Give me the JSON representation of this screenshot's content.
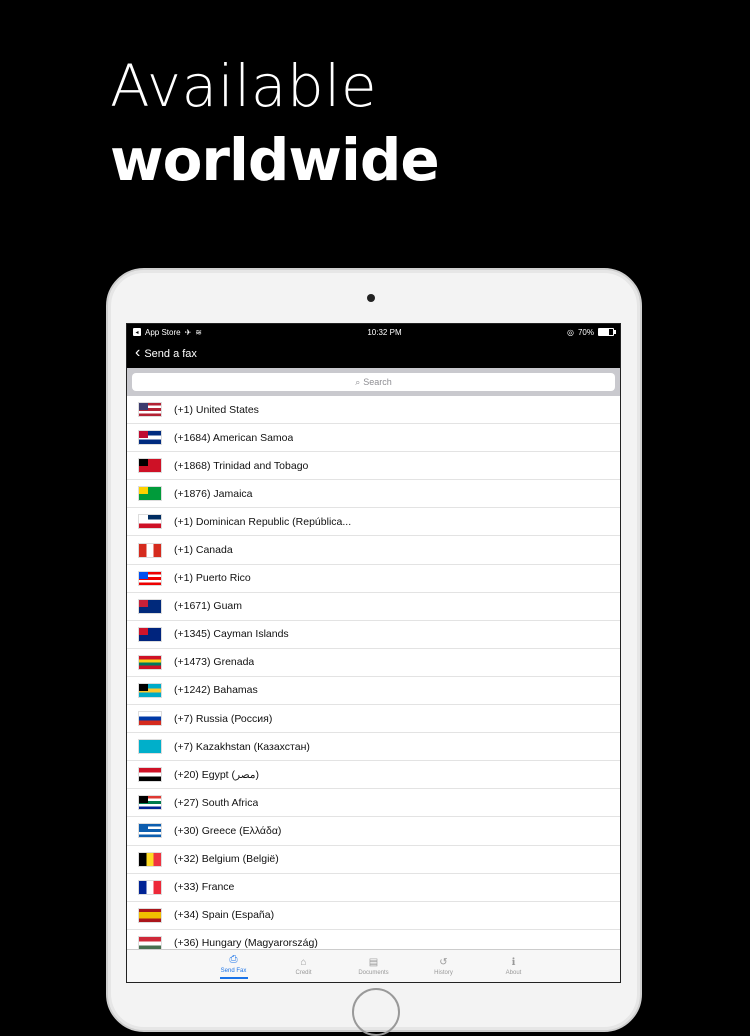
{
  "headline": {
    "line1": "Available",
    "line2": "worldwide"
  },
  "statusbar": {
    "back_app": "App Store",
    "time": "10:32 PM",
    "battery": "70%",
    "battery_level": 0.7
  },
  "navbar": {
    "back_label": "Send a fax"
  },
  "search": {
    "placeholder": "Search"
  },
  "countries": [
    {
      "label": "(+1) United States",
      "flag": [
        "#b22234",
        "#ffffff",
        "#b22234",
        "#ffffff",
        "#b22234"
      ],
      "canton": "#3c3b6e"
    },
    {
      "label": "(+1684) American Samoa",
      "flag": [
        "#002b7f",
        "#ffffff",
        "#002b7f"
      ],
      "canton": "#bf0a30"
    },
    {
      "label": "(+1868) Trinidad and Tobago",
      "flag": [
        "#ce1126"
      ],
      "canton": "#000000"
    },
    {
      "label": "(+1876) Jamaica",
      "flag": [
        "#009b3a"
      ],
      "canton": "#fed100"
    },
    {
      "label": "(+1) Dominican Republic (República...",
      "flag": [
        "#002d62",
        "#ffffff",
        "#ce1126"
      ],
      "canton": "#ffffff"
    },
    {
      "label": "(+1) Canada",
      "flag": [
        "#d52b1e",
        "#ffffff",
        "#d52b1e"
      ],
      "canton": "",
      "vertical": true
    },
    {
      "label": "(+1) Puerto Rico",
      "flag": [
        "#ed0000",
        "#ffffff",
        "#ed0000",
        "#ffffff",
        "#ed0000"
      ],
      "canton": "#0050f0"
    },
    {
      "label": "(+1671) Guam",
      "flag": [
        "#00297b"
      ],
      "canton": "#c62139"
    },
    {
      "label": "(+1345) Cayman Islands",
      "flag": [
        "#00247d"
      ],
      "canton": "#cf142b"
    },
    {
      "label": "(+1473) Grenada",
      "flag": [
        "#ce1126",
        "#fcd116",
        "#007a5e",
        "#ce1126"
      ],
      "canton": ""
    },
    {
      "label": "(+1242) Bahamas",
      "flag": [
        "#00abc9",
        "#ffc72c",
        "#00abc9"
      ],
      "canton": "#000000"
    },
    {
      "label": "(+7) Russia (Россия)",
      "flag": [
        "#ffffff",
        "#0039a6",
        "#d52b1e"
      ],
      "canton": ""
    },
    {
      "label": "(+7) Kazakhstan (Казахстан)",
      "flag": [
        "#00afca"
      ],
      "canton": ""
    },
    {
      "label": "(+20) Egypt (مصر)",
      "flag": [
        "#ce1126",
        "#ffffff",
        "#000000"
      ],
      "canton": ""
    },
    {
      "label": "(+27) South Africa",
      "flag": [
        "#de3831",
        "#ffffff",
        "#007a4d",
        "#ffffff",
        "#002395"
      ],
      "canton": "#000000"
    },
    {
      "label": "(+30) Greece (Ελλάδα)",
      "flag": [
        "#0d5eaf",
        "#ffffff",
        "#0d5eaf",
        "#ffffff",
        "#0d5eaf"
      ],
      "canton": "#0d5eaf"
    },
    {
      "label": "(+32) Belgium (België)",
      "flag": [
        "#000000",
        "#fdda24",
        "#ef3340"
      ],
      "canton": "",
      "vertical": true
    },
    {
      "label": "(+33) France",
      "flag": [
        "#002395",
        "#ffffff",
        "#ed2939"
      ],
      "canton": "",
      "vertical": true
    },
    {
      "label": "(+34) Spain (España)",
      "flag": [
        "#aa151b",
        "#f1bf00",
        "#f1bf00",
        "#aa151b"
      ],
      "canton": ""
    },
    {
      "label": "(+36) Hungary (Magyarország)",
      "flag": [
        "#ce2939",
        "#ffffff",
        "#477050"
      ],
      "canton": ""
    }
  ],
  "tabs": [
    {
      "label": "Send Fax",
      "icon": "printer-icon",
      "glyph": "⎙",
      "active": true
    },
    {
      "label": "Credit",
      "icon": "store-icon",
      "glyph": "⌂",
      "active": false
    },
    {
      "label": "Documents",
      "icon": "document-icon",
      "glyph": "▤",
      "active": false
    },
    {
      "label": "History",
      "icon": "history-icon",
      "glyph": "↺",
      "active": false
    },
    {
      "label": "About",
      "icon": "info-icon",
      "glyph": "ℹ",
      "active": false
    }
  ]
}
